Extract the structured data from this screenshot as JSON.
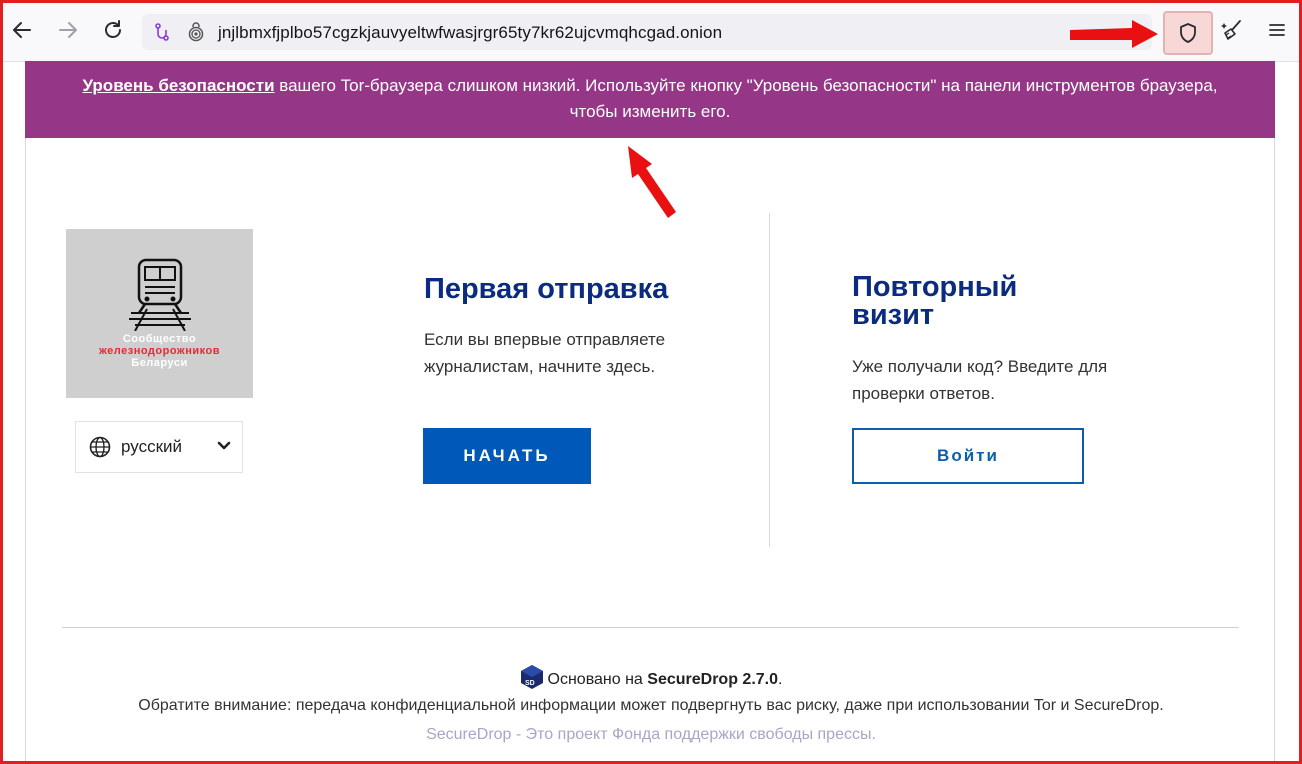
{
  "browser": {
    "url": "jnjlbmxfjplbo57cgzkjauvyeltwfwasjrgr65ty7kr62ujcvmqhcgad.onion"
  },
  "banner": {
    "link_text": "Уровень безопасности",
    "line1_rest": " вашего Tor-браузера слишком низкий. Используйте кнопку \"Уровень безопасности\" на панели инструментов браузера,",
    "line2": "чтобы изменить его."
  },
  "logo": {
    "line1": "Сообщество",
    "line2": "железнодорожников",
    "line3": "Беларуси"
  },
  "language": {
    "selected": "русский"
  },
  "first": {
    "title": "Первая отправка",
    "desc_line1": "Если вы впервые отправляете",
    "desc_line2": "журналистам, начните здесь.",
    "button": "НАЧАТЬ"
  },
  "repeat": {
    "title_line1": "Повторный",
    "title_line2": "визит",
    "desc_line1": "Уже получали код? Введите для",
    "desc_line2": "проверки ответов.",
    "button": "Войти"
  },
  "footer": {
    "powered_prefix": "Основано на ",
    "powered_name": "SecureDrop 2.7.0",
    "powered_suffix": ".",
    "warning": "Обратите внимание: передача конфиденциальной информации может подвергнуть вас риску, даже при использовании Tor и SecureDrop.",
    "project": "SecureDrop - Это проект Фонда поддержки свободы прессы."
  },
  "colors": {
    "banner_bg": "#953786",
    "heading": "#0b2b80",
    "primary_button": "#0059b8",
    "annotation_arrow": "#e81010"
  }
}
